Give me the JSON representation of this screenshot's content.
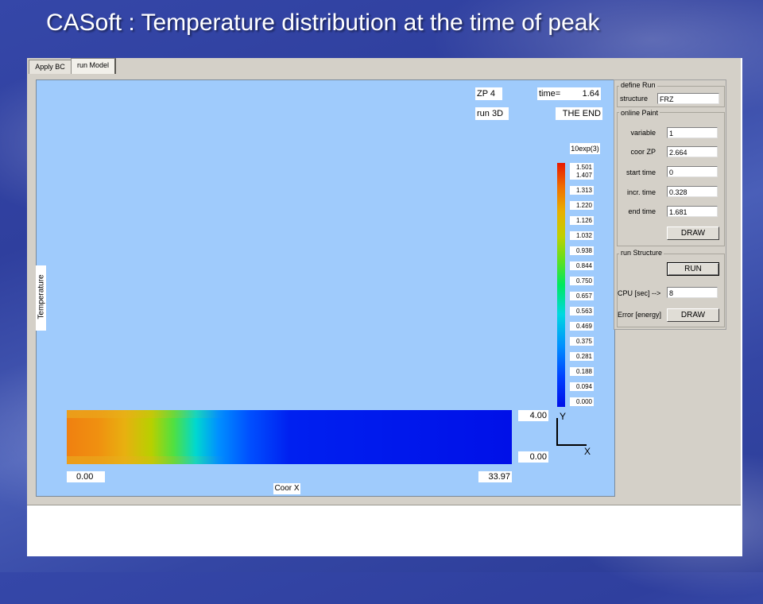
{
  "slide": {
    "title": "CASoft : Temperature distribution at the time of peak"
  },
  "tabs": {
    "apply_bc": "Apply BC",
    "run_model": "run Model"
  },
  "plot": {
    "zp_label": "ZP 4",
    "time_label": "time=",
    "time_value": "1.64",
    "run_label": "run 3D",
    "end_label": "THE END",
    "scale_label": "10exp(3)",
    "y_axis_title": "Temperature",
    "x_axis_title": "Coor X",
    "x_min": "0.00",
    "x_max": "33.97",
    "y_min": "0.00",
    "y_max": "4.00",
    "axis_y": "Y",
    "axis_x": "X",
    "colorbar_ticks": [
      "1.501",
      "1.407",
      "1.313",
      "1.220",
      "1.126",
      "1.032",
      "0.938",
      "0.844",
      "0.750",
      "0.657",
      "0.563",
      "0.469",
      "0.375",
      "0.281",
      "0.188",
      "0.094",
      "0.000"
    ]
  },
  "side_panel": {
    "define_run": {
      "title": "define Run",
      "structure_label": "structure",
      "structure_value": "FRZ"
    },
    "online_paint": {
      "title": "online Paint",
      "variable_label": "variable",
      "variable_value": "1",
      "coor_zp_label": "coor ZP",
      "coor_zp_value": "2.664",
      "start_time_label": "start time",
      "start_time_value": "0",
      "incr_time_label": "incr. time",
      "incr_time_value": "0.328",
      "end_time_label": "end time",
      "end_time_value": "1.681",
      "draw_label": "DRAW"
    },
    "run_structure": {
      "title": "run Structure",
      "run_label": "RUN",
      "cpu_label": "CPU [sec] -->",
      "cpu_value": "8",
      "error_label": "Error [energy]",
      "draw_label": "DRAW"
    }
  }
}
